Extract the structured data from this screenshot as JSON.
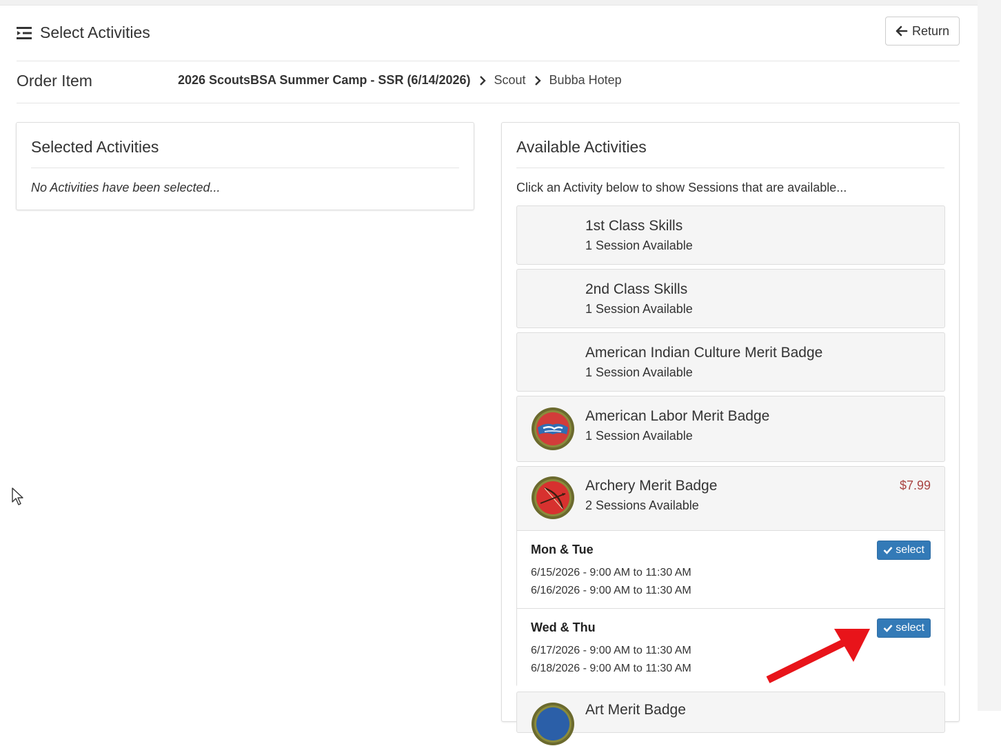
{
  "header": {
    "title": "Select Activities",
    "return_label": "Return"
  },
  "order": {
    "label": "Order Item",
    "breadcrumb": [
      "2026 ScoutsBSA Summer Camp - SSR (6/14/2026)",
      "Scout",
      "Bubba Hotep"
    ]
  },
  "selected_panel": {
    "title": "Selected Activities",
    "empty_text": "No Activities have been selected..."
  },
  "available_panel": {
    "title": "Available Activities",
    "hint": "Click an Activity below to show Sessions that are available...",
    "activities": [
      {
        "title": "1st Class Skills",
        "sessions_text": "1 Session Available"
      },
      {
        "title": "2nd Class Skills",
        "sessions_text": "1 Session Available"
      },
      {
        "title": "American Indian Culture Merit Badge",
        "sessions_text": "1 Session Available"
      },
      {
        "title": "American Labor Merit Badge",
        "sessions_text": "1 Session Available",
        "icon": "american-labor-badge-icon"
      },
      {
        "title": "Archery Merit Badge",
        "sessions_text": "2 Sessions Available",
        "price": "$7.99",
        "icon": "archery-badge-icon",
        "sessions": [
          {
            "name": "Mon & Tue",
            "dates": [
              "6/15/2026 - 9:00 AM to 11:30 AM",
              "6/16/2026 - 9:00 AM to 11:30 AM"
            ],
            "button": "select"
          },
          {
            "name": "Wed & Thu",
            "dates": [
              "6/17/2026 - 9:00 AM to 11:30 AM",
              "6/18/2026 - 9:00 AM to 11:30 AM"
            ],
            "button": "select"
          }
        ]
      },
      {
        "title": "Art Merit Badge",
        "icon": "art-badge-icon"
      }
    ]
  },
  "colors": {
    "primary": "#337ab7",
    "price": "#a94442",
    "annotation_arrow": "#e8141a"
  }
}
